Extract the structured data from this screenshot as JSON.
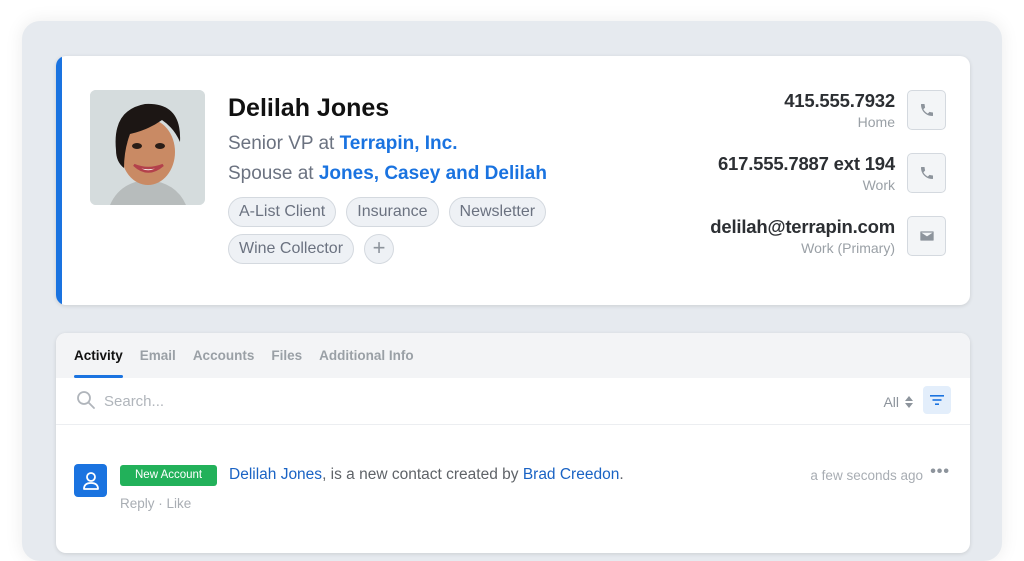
{
  "contact": {
    "name": "Delilah Jones",
    "roles": [
      {
        "prefix": "Senior VP at",
        "link": "Terrapin, Inc."
      },
      {
        "prefix": "Spouse at",
        "link": "Jones, Casey and Delilah"
      }
    ],
    "tags": [
      "A-List Client",
      "Insurance",
      "Newsletter",
      "Wine Collector"
    ],
    "add_tag_label": "+",
    "accent_color": "#1a73e0",
    "methods": [
      {
        "value": "415.555.7932",
        "label": "Home",
        "icon": "phone-icon"
      },
      {
        "value": "617.555.7887 ext 194",
        "label": "Work",
        "icon": "phone-icon"
      },
      {
        "value": "delilah@terrapin.com",
        "label": "Work (Primary)",
        "icon": "mail-icon"
      }
    ]
  },
  "activity": {
    "tabs": [
      {
        "label": "Activity",
        "active": true
      },
      {
        "label": "Email",
        "active": false
      },
      {
        "label": "Accounts",
        "active": false
      },
      {
        "label": "Files",
        "active": false
      },
      {
        "label": "Additional Info",
        "active": false
      }
    ],
    "search": {
      "placeholder": "Search...",
      "value": ""
    },
    "filter": {
      "selected": "All",
      "icon": "filter-icon"
    },
    "items": [
      {
        "badge": "New Account",
        "badge_color": "#22b15a",
        "subject_link": "Delilah Jones",
        "text": ", is a new contact created by ",
        "actor_link": "Brad Creedon",
        "suffix": ".",
        "time": "a few seconds ago",
        "more_label": "•••",
        "actions": {
          "reply": "Reply",
          "separator": " · ",
          "like": "Like"
        }
      }
    ]
  }
}
